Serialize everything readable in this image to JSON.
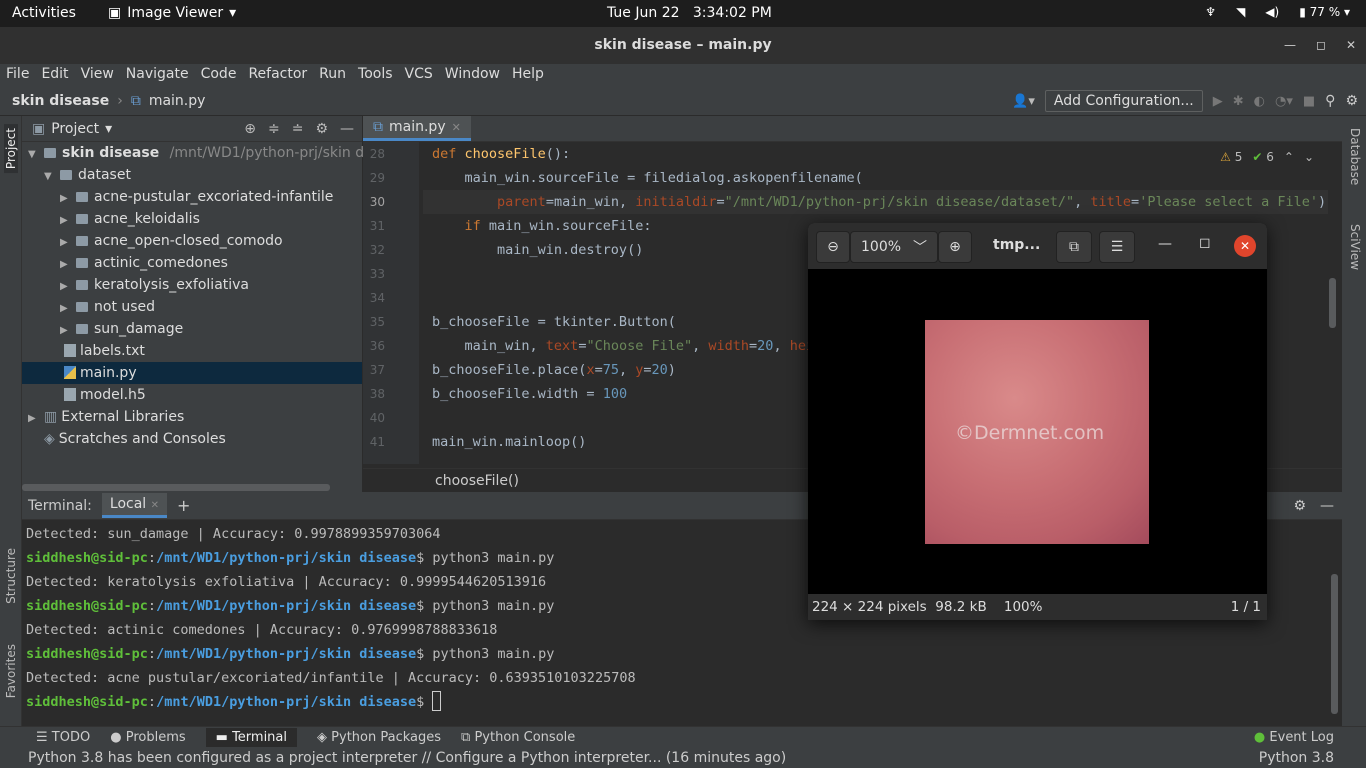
{
  "gnome": {
    "activities": "Activities",
    "app": "Image Viewer",
    "date": "Tue Jun 22",
    "time": "3:34:02 PM",
    "battery": "77 %"
  },
  "window": {
    "title": "skin disease – main.py"
  },
  "menu": [
    "File",
    "Edit",
    "View",
    "Navigate",
    "Code",
    "Refactor",
    "Run",
    "Tools",
    "VCS",
    "Window",
    "Help"
  ],
  "nav": {
    "project": "skin disease",
    "file": "main.py",
    "add_config": "Add Configuration..."
  },
  "project_panel": {
    "title": "Project",
    "root": "skin disease",
    "root_path": "/mnt/WD1/python-prj/skin dis",
    "folder": "dataset",
    "subfolders": [
      "acne-pustular_excoriated-infantile",
      "acne_keloidalis",
      "acne_open-closed_comodo",
      "actinic_comedones",
      "keratolysis_exfoliativa",
      "not used",
      "sun_damage"
    ],
    "files": [
      "labels.txt",
      "main.py",
      "model.h5"
    ],
    "external": "External Libraries",
    "scratches": "Scratches and Consoles"
  },
  "side_tabs": {
    "left": [
      "Project",
      "Structure",
      "Favorites"
    ],
    "right": [
      "Database",
      "SciView"
    ]
  },
  "editor": {
    "tab": "main.py",
    "line_numbers": [
      "28",
      "29",
      "30",
      "31",
      "32",
      "33",
      "34",
      "35",
      "36",
      "37",
      "38",
      "40",
      "41"
    ],
    "warnings": "5",
    "checks": "6",
    "breadcrumb": "chooseFile()"
  },
  "terminal": {
    "title": "Terminal:",
    "tab": "Local",
    "lines": [
      {
        "type": "out",
        "text": "Detected: sun_damage | Accuracy: 0.9978899359703064"
      },
      {
        "type": "prompt",
        "user": "siddhesh@sid-pc",
        "path": "/mnt/WD1/python-prj/skin disease",
        "cmd": "$ python3 main.py"
      },
      {
        "type": "out",
        "text": "Detected: keratolysis exfoliativa | Accuracy: 0.9999544620513916"
      },
      {
        "type": "prompt",
        "user": "siddhesh@sid-pc",
        "path": "/mnt/WD1/python-prj/skin disease",
        "cmd": "$ python3 main.py"
      },
      {
        "type": "out",
        "text": "Detected: actinic comedones | Accuracy: 0.9769998788833618"
      },
      {
        "type": "prompt",
        "user": "siddhesh@sid-pc",
        "path": "/mnt/WD1/python-prj/skin disease",
        "cmd": "$ python3 main.py"
      },
      {
        "type": "out",
        "text": "Detected: acne pustular/excoriated/infantile | Accuracy: 0.6393510103225708"
      },
      {
        "type": "prompt",
        "user": "siddhesh@sid-pc",
        "path": "/mnt/WD1/python-prj/skin disease",
        "cmd": "$ "
      }
    ]
  },
  "toolwindows": [
    "TODO",
    "Problems",
    "Terminal",
    "Python Packages",
    "Python Console"
  ],
  "event_log": "Event Log",
  "status": {
    "message": "Python 3.8 has been configured as a project interpreter // Configure a Python interpreter... (16 minutes ago)",
    "interpreter": "Python 3.8"
  },
  "viewer": {
    "zoom": "100%",
    "title": "tmp...",
    "image_info": "224 × 224 pixels  98.2 kB    100%",
    "page": "1 / 1",
    "watermark": "©Dermnet.com"
  }
}
